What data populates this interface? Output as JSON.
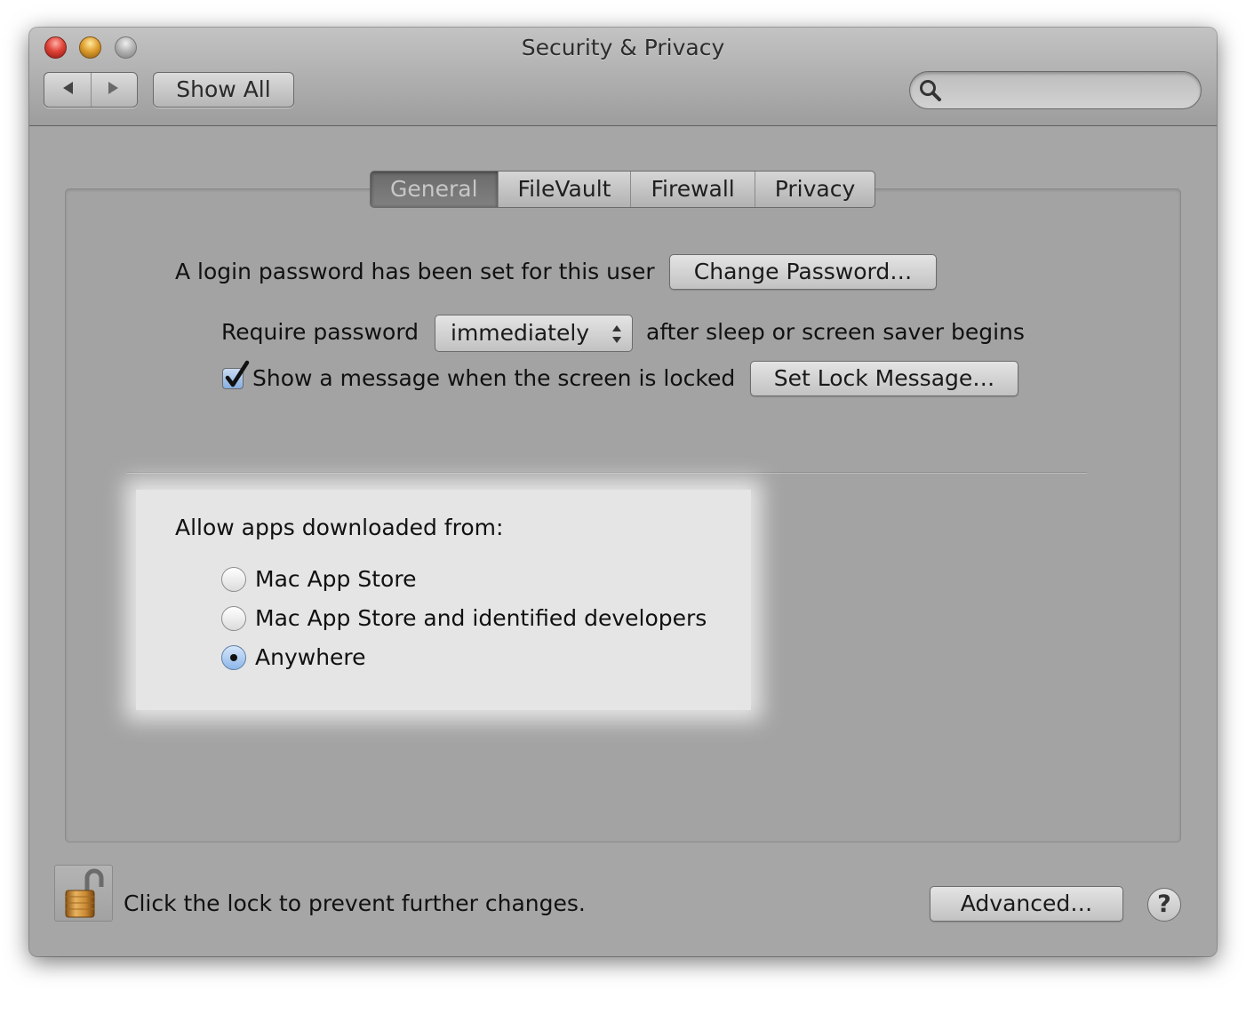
{
  "window": {
    "title": "Security & Privacy"
  },
  "toolbar": {
    "back_icon": "back-arrow-icon",
    "forward_icon": "forward-arrow-icon",
    "show_all_label": "Show All",
    "search_placeholder": "",
    "search_icon": "search-icon"
  },
  "tabs": [
    {
      "label": "General",
      "active": true
    },
    {
      "label": "FileVault",
      "active": false
    },
    {
      "label": "Firewall",
      "active": false
    },
    {
      "label": "Privacy",
      "active": false
    }
  ],
  "general": {
    "login_text": "A login password has been set for this user",
    "change_password_label": "Change Password…",
    "require_password_label": "Require password",
    "require_password_value": "immediately",
    "after_sleep_text": "after sleep or screen saver begins",
    "show_message_label": "Show a message when the screen is locked",
    "show_message_checked": true,
    "set_lock_message_label": "Set Lock Message…"
  },
  "gatekeeper": {
    "title": "Allow apps downloaded from:",
    "options": [
      {
        "label": "Mac App Store",
        "selected": false
      },
      {
        "label": "Mac App Store and identified developers",
        "selected": false
      },
      {
        "label": "Anywhere",
        "selected": true
      }
    ]
  },
  "footer": {
    "lock_icon": "unlocked-padlock-icon",
    "lock_text": "Click the lock to prevent further changes.",
    "advanced_label": "Advanced…",
    "help_label": "?"
  },
  "colors": {
    "window_bg": "#a6a6a6",
    "highlight_bg": "#e5e5e5",
    "radio_selected": "#8db7ea"
  }
}
